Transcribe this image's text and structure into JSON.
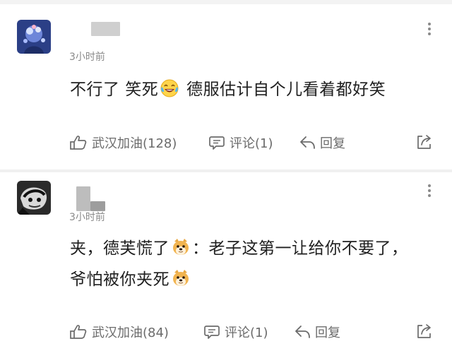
{
  "comments": [
    {
      "time": "3小时前",
      "text_before_emoji": "不行了 笑死",
      "text_after_emoji": " 德服估计自个儿看着都好笑",
      "emoji_icon": "laughing-tears-icon",
      "like_label": "武汉加油(128)",
      "reply_count_label": "评论(1)",
      "reply_label": "回复"
    },
    {
      "time": "3小时前",
      "line1_before_emoji": "夹，德芙慌了",
      "line1_after_emoji": "：老子这第一让给你不要了，",
      "line2_before_emoji": "爷怕被你夹死",
      "emoji_icon": "doge-icon",
      "like_label": "武汉加油(84)",
      "reply_count_label": "评论(1)",
      "reply_label": "回复"
    }
  ],
  "colors": {
    "text": "#1f1f1f",
    "secondary": "#8a8a8a",
    "action": "#6b6b6b",
    "separator": "#f0f0f0"
  }
}
